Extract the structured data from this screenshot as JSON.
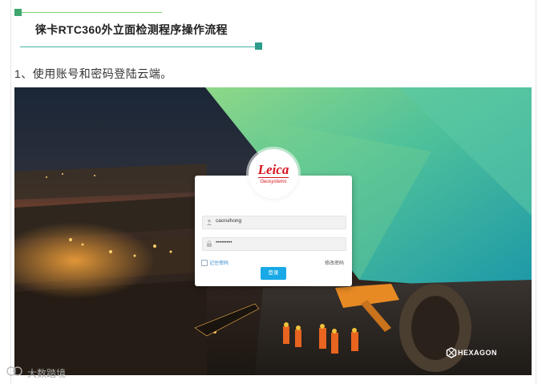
{
  "article": {
    "section_title": "徕卡RTC360外立面检测程序操作流程",
    "step_text": "1、使用账号和密码登陆云端。"
  },
  "login": {
    "logo_brand": "Leica",
    "logo_sub": "Geosystems",
    "username": "caoruihong",
    "password": "•••••••••",
    "remember_label": "记住密码",
    "change_password": "修改密码",
    "login_button": "登录",
    "partner_brand": "HEXAGON"
  },
  "colors": {
    "accent_green": "#3fa66c",
    "accent_teal": "#2d9c8a",
    "login_button": "#18a9e6",
    "leica_red": "#d6131f"
  },
  "watermark": {
    "text": "大数踏境"
  }
}
